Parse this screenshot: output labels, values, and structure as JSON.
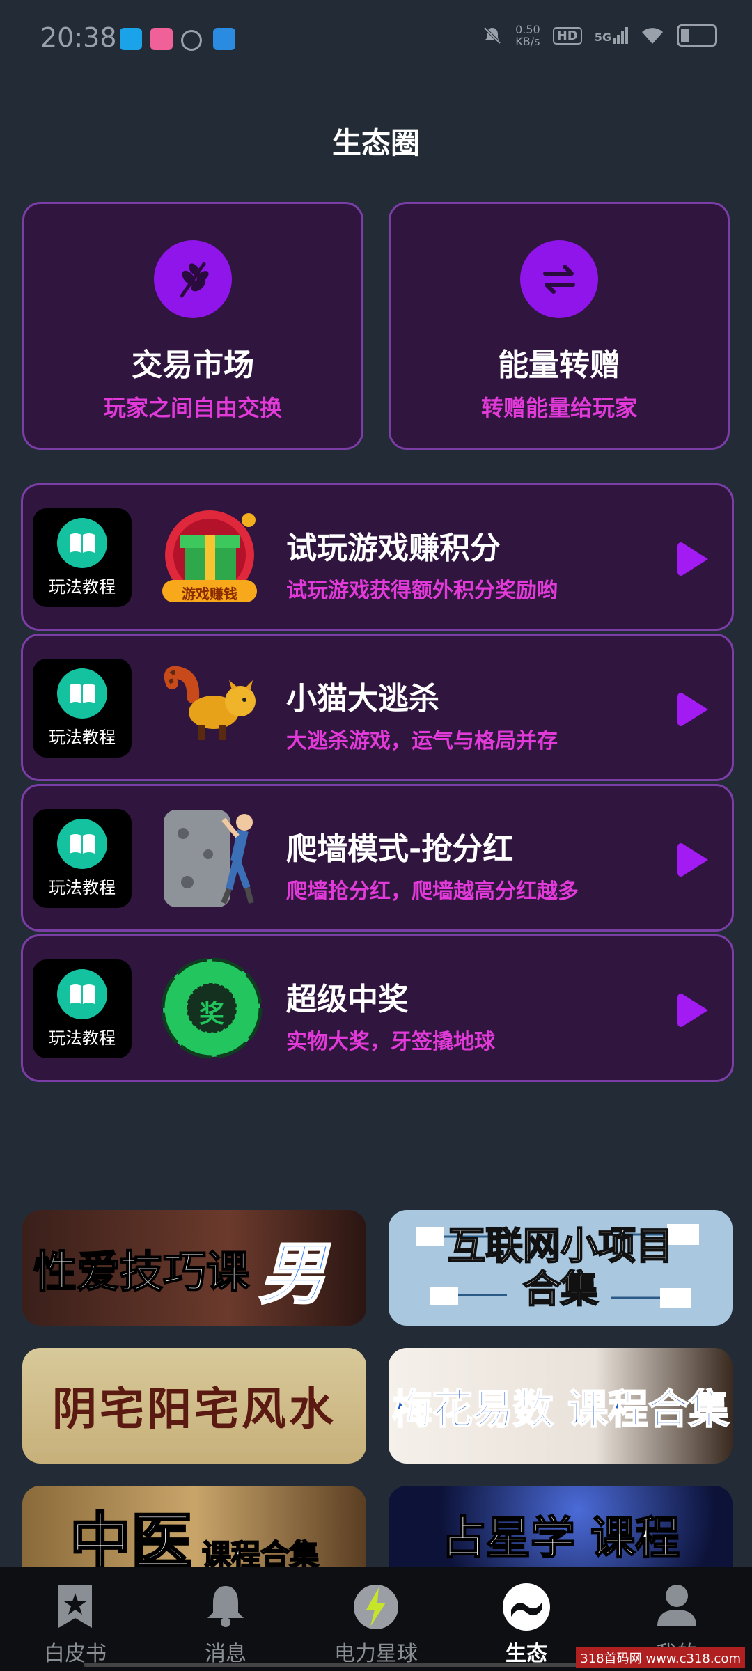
{
  "status_bar": {
    "time": "20:38",
    "net_speed": "0.50\nKB/s",
    "hd": "HD",
    "signal": "5G"
  },
  "page": {
    "title": "生态圈"
  },
  "top_cards": [
    {
      "title": "交易市场",
      "subtitle": "玩家之间自由交换",
      "icon": "leaf-icon"
    },
    {
      "title": "能量转赠",
      "subtitle": "转赠能量给玩家",
      "icon": "swap-arrows-icon"
    }
  ],
  "tutorial_label": "玩法教程",
  "games": [
    {
      "title": "试玩游戏赚积分",
      "subtitle": "试玩游戏获得额外积分奖励哟",
      "badge": "游戏赚钱",
      "thumb": "gift-box-icon"
    },
    {
      "title": "小猫大逃杀",
      "subtitle": "大逃杀游戏，运气与格局并存",
      "thumb": "raccoon-cat-icon"
    },
    {
      "title": "爬墙模式-抢分红",
      "subtitle": "爬墙抢分红，爬墙越高分红越多",
      "thumb": "wall-climber-icon"
    },
    {
      "title": "超级中奖",
      "subtitle": "实物大奖，牙签撬地球",
      "badge": "奖",
      "thumb": "prize-wheel-icon"
    }
  ],
  "banners": [
    {
      "text": "性爱技巧课",
      "extra": "男"
    },
    {
      "text": "互联网小项目\n合集"
    },
    {
      "text": "阴宅阳宅风水"
    },
    {
      "text": "梅花易数 课程合集"
    },
    {
      "text": "中医",
      "extra": "课程合集"
    },
    {
      "text": "占星学 课程"
    }
  ],
  "tabs": [
    {
      "label": "白皮书",
      "icon": "star-book-icon"
    },
    {
      "label": "消息",
      "icon": "bell-icon"
    },
    {
      "label": "电力星球",
      "icon": "lightning-planet-icon"
    },
    {
      "label": "生态",
      "icon": "eco-wave-icon",
      "active": true
    },
    {
      "label": "我的",
      "icon": "user-icon"
    }
  ],
  "watermark": "318首码网 www.c318.com",
  "colors": {
    "background": "#222b36",
    "card": "#30153f",
    "card_border": "#7a3ea6",
    "accent_purple": "#8f15ea",
    "subtitle_pink": "#e23ad8"
  }
}
